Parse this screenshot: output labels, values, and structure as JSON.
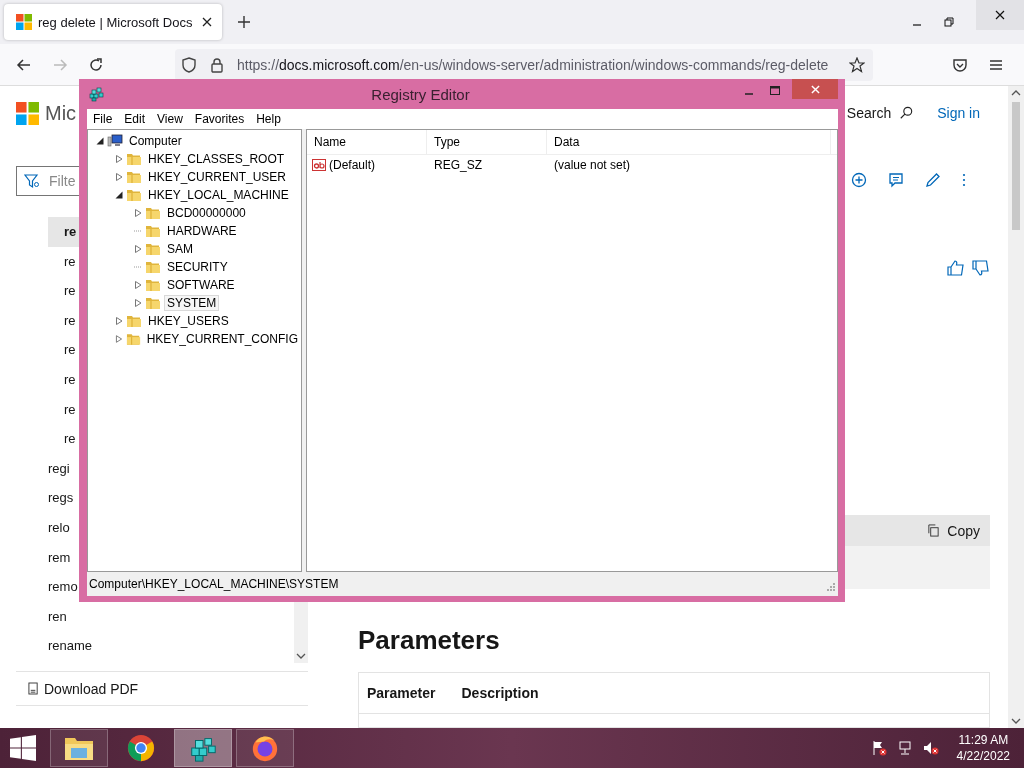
{
  "browser": {
    "tab": {
      "title": "reg delete | Microsoft Docs",
      "selected": true
    },
    "address": {
      "scheme": "https://",
      "host": "docs.microsoft.com",
      "path": "/en-us/windows-server/administration/windows-commands/reg-delete"
    }
  },
  "docs": {
    "header": {
      "brand": "Mic",
      "search": "Search",
      "sign_in": "Sign in"
    },
    "filter": {
      "placeholder": "Filte"
    },
    "nav": [
      {
        "children": [
          {
            "label": "re",
            "selected": true
          },
          {
            "label": "re",
            "selected": false
          },
          {
            "label": "re",
            "selected": false
          },
          {
            "label": "re",
            "selected": false
          },
          {
            "label": "re",
            "selected": false
          },
          {
            "label": "re",
            "selected": false
          },
          {
            "label": "re",
            "selected": false
          },
          {
            "label": "re",
            "selected": false
          }
        ]
      },
      {
        "label": "regi",
        "selected": false
      },
      {
        "label": "regs",
        "selected": false
      },
      {
        "label": "relo",
        "selected": false
      },
      {
        "label": "rem",
        "selected": false
      },
      {
        "label": "remo",
        "selected": false
      },
      {
        "label": "ren",
        "selected": false
      },
      {
        "label": "rename",
        "selected": false
      }
    ],
    "download": "Download PDF",
    "code_block": {
      "copy": "Copy"
    },
    "heading": "Parameters",
    "table": {
      "columns": [
        "Parameter",
        "Description"
      ]
    }
  },
  "regedit": {
    "title": "Registry Editor",
    "menu": [
      "File",
      "Edit",
      "View",
      "Favorites",
      "Help"
    ],
    "tree": [
      {
        "label": "Computer",
        "kind": "computer",
        "expandable": true,
        "expanded": true,
        "selected": false,
        "children": [
          {
            "label": "HKEY_CLASSES_ROOT",
            "kind": "folder",
            "expandable": true,
            "expanded": false,
            "selected": false
          },
          {
            "label": "HKEY_CURRENT_USER",
            "kind": "folder",
            "expandable": true,
            "expanded": false,
            "selected": false
          },
          {
            "label": "HKEY_LOCAL_MACHINE",
            "kind": "folder",
            "expandable": true,
            "expanded": true,
            "selected": false,
            "children": [
              {
                "label": "BCD00000000",
                "kind": "folder",
                "expandable": true,
                "expanded": false,
                "selected": false
              },
              {
                "label": "HARDWARE",
                "kind": "folder",
                "expandable": false,
                "expanded": false,
                "selected": false
              },
              {
                "label": "SAM",
                "kind": "folder",
                "expandable": true,
                "expanded": false,
                "selected": false
              },
              {
                "label": "SECURITY",
                "kind": "folder",
                "expandable": false,
                "expanded": false,
                "selected": false
              },
              {
                "label": "SOFTWARE",
                "kind": "folder",
                "expandable": true,
                "expanded": false,
                "selected": false
              },
              {
                "label": "SYSTEM",
                "kind": "folder",
                "expandable": true,
                "expanded": false,
                "selected": true
              }
            ]
          },
          {
            "label": "HKEY_USERS",
            "kind": "folder",
            "expandable": true,
            "expanded": false,
            "selected": false
          },
          {
            "label": "HKEY_CURRENT_CONFIG",
            "kind": "folder",
            "expandable": true,
            "expanded": false,
            "selected": false
          }
        ]
      }
    ],
    "columns": [
      "Name",
      "Type",
      "Data"
    ],
    "values": [
      {
        "name": "(Default)",
        "type": "REG_SZ",
        "data": "(value not set)"
      }
    ],
    "status": "Computer\\HKEY_LOCAL_MACHINE\\SYSTEM"
  },
  "taskbar": {
    "apps": [
      {
        "kind": "explorer",
        "open": true,
        "selected": false
      },
      {
        "kind": "chrome",
        "open": false,
        "selected": false
      },
      {
        "kind": "regedit",
        "open": true,
        "selected": true
      },
      {
        "kind": "firefox",
        "open": true,
        "selected": false
      }
    ],
    "time": "11:29 AM",
    "date": "4/22/2022"
  }
}
